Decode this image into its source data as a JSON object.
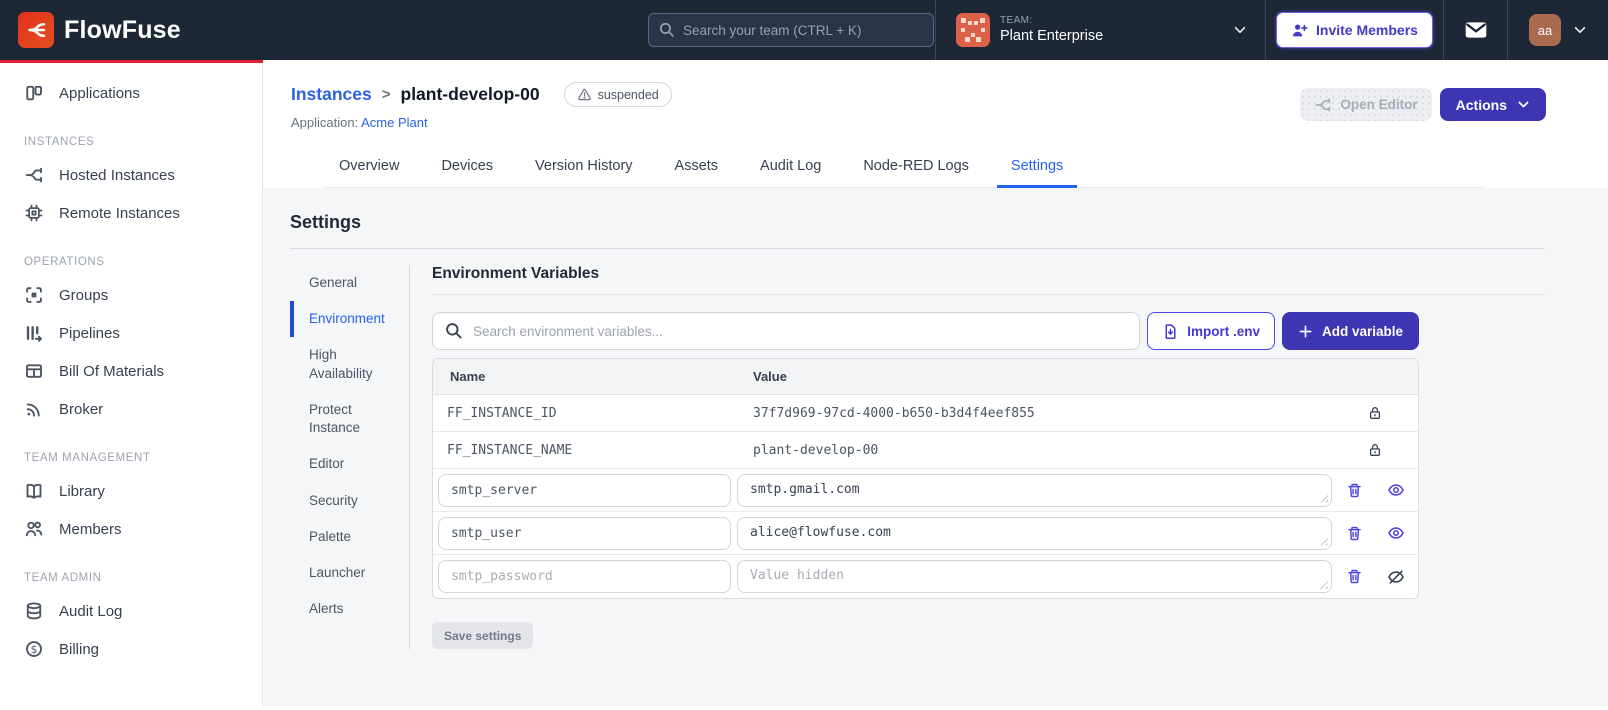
{
  "header": {
    "brand": "FlowFuse",
    "search_placeholder": "Search your team (CTRL + K)",
    "team_label": "TEAM:",
    "team_name": "Plant Enterprise",
    "invite_button": "Invite Members",
    "avatar_initials": "aa"
  },
  "sidebar": {
    "sections": [
      {
        "label": "",
        "items": [
          {
            "label": "Applications",
            "icon": "applications-icon"
          }
        ]
      },
      {
        "label": "INSTANCES",
        "items": [
          {
            "label": "Hosted Instances",
            "icon": "fork-icon"
          },
          {
            "label": "Remote Instances",
            "icon": "chip-icon"
          }
        ]
      },
      {
        "label": "OPERATIONS",
        "items": [
          {
            "label": "Groups",
            "icon": "groups-chip-icon"
          },
          {
            "label": "Pipelines",
            "icon": "pipelines-icon"
          },
          {
            "label": "Bill Of Materials",
            "icon": "table-icon"
          },
          {
            "label": "Broker",
            "icon": "broadcast-icon"
          }
        ]
      },
      {
        "label": "TEAM MANAGEMENT",
        "items": [
          {
            "label": "Library",
            "icon": "book-icon"
          },
          {
            "label": "Members",
            "icon": "members-icon"
          }
        ]
      },
      {
        "label": "TEAM ADMIN",
        "items": [
          {
            "label": "Audit Log",
            "icon": "database-icon"
          },
          {
            "label": "Billing",
            "icon": "dollar-icon"
          }
        ]
      }
    ]
  },
  "breadcrumb": {
    "parent": "Instances",
    "separator": ">",
    "current": "plant-develop-00",
    "status_badge": "suspended",
    "application_label": "Application:",
    "application_name": "Acme Plant"
  },
  "header_buttons": {
    "open_editor": "Open Editor",
    "actions": "Actions"
  },
  "tabs": {
    "items": [
      {
        "label": "Overview"
      },
      {
        "label": "Devices"
      },
      {
        "label": "Version History"
      },
      {
        "label": "Assets"
      },
      {
        "label": "Audit Log"
      },
      {
        "label": "Node-RED Logs"
      },
      {
        "label": "Settings"
      }
    ],
    "active": "Settings"
  },
  "settings": {
    "title": "Settings",
    "nav": {
      "items": [
        {
          "label": "General"
        },
        {
          "label": "Environment"
        },
        {
          "label": "High Availability"
        },
        {
          "label": "Protect Instance"
        },
        {
          "label": "Editor"
        },
        {
          "label": "Security"
        },
        {
          "label": "Palette"
        },
        {
          "label": "Launcher"
        },
        {
          "label": "Alerts"
        }
      ],
      "active": "Environment"
    },
    "env": {
      "title": "Environment Variables",
      "search_placeholder": "Search environment variables...",
      "import_button": "Import .env",
      "add_button": "Add variable",
      "columns": {
        "name": "Name",
        "value": "Value"
      },
      "locked_rows": [
        {
          "name": "FF_INSTANCE_ID",
          "value": "37f7d969-97cd-4000-b650-b3d4f4eef855"
        },
        {
          "name": "FF_INSTANCE_NAME",
          "value": "plant-develop-00"
        }
      ],
      "editable_rows": [
        {
          "name": "smtp_server",
          "value": "smtp.gmail.com",
          "hidden": false
        },
        {
          "name": "smtp_user",
          "value": "alice@flowfuse.com",
          "hidden": false
        },
        {
          "name": "smtp_password",
          "value": "",
          "value_placeholder": "Value hidden",
          "hidden": true
        }
      ],
      "save_button": "Save settings"
    }
  },
  "colors": {
    "navbar_bg": "#1e2736",
    "brand_red": "#e02330",
    "primary_indigo": "#3d35b2",
    "icon_indigo": "#4f46e5",
    "link_blue": "#2d62e4",
    "active_tab_blue": "#2563eb",
    "body_gray": "#f5f6f8"
  }
}
